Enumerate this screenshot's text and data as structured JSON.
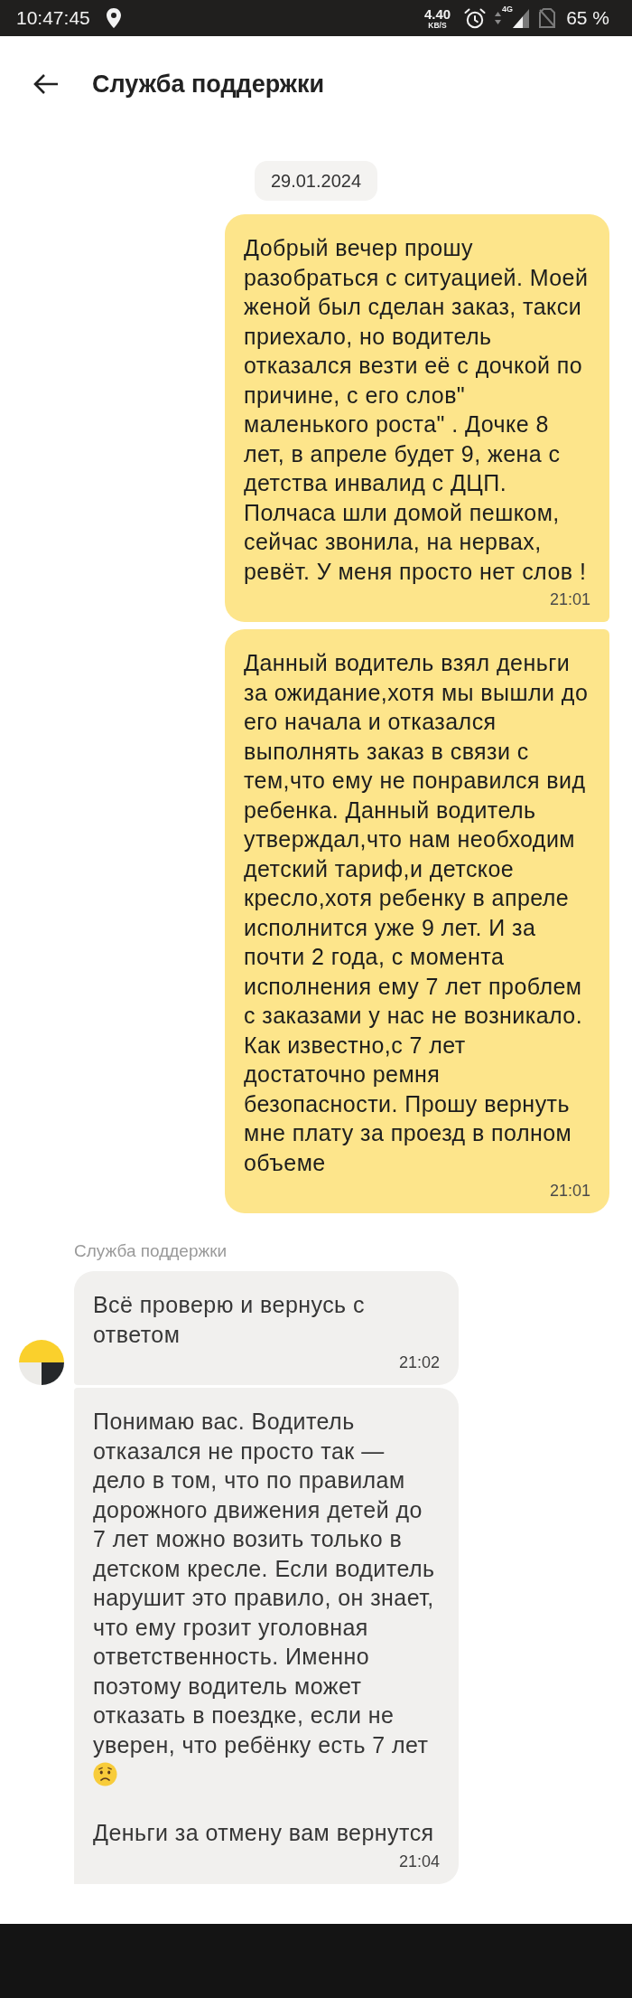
{
  "status_bar": {
    "time": "10:47:45",
    "net_speed": "4.40",
    "net_speed_unit": "KB/S",
    "network_type": "4G",
    "battery": "65 %"
  },
  "header": {
    "title": "Служба поддержки"
  },
  "chat": {
    "date": "29.01.2024",
    "groups": [
      {
        "kind": "outgoing",
        "messages": [
          {
            "time": "21:01",
            "parts": [
              {
                "kind": "text",
                "text": "Добрый вечер прошу разобраться с ситуацией. Моей женой был сделан заказ, такси приехало, но водитель отказался везти её с дочкой по причине, с его слов\" маленького роста\" . Дочке 8 лет, в апреле будет 9, жена с детства инвалид с ДЦП. Полчаса шли домой пешком, сейчас звонила, на нервах, ревёт. У меня просто нет слов !"
              }
            ]
          },
          {
            "time": "21:01",
            "parts": [
              {
                "kind": "text",
                "text": "Данный водитель взял деньги за ожидание,хотя мы вышли до его начала и отказался выполнять заказ в связи с тем,что ему не понравился вид ребенка. Данный водитель утверждал,что нам необходим детский тариф,и детское кресло,хотя ребенку в апреле исполнится уже 9 лет. И за почти 2 года, с момента исполнения ему 7 лет проблем с заказами у нас не возникало. Как известно,с 7 лет достаточно ремня безопасности. Прошу вернуть мне плату за проезд в полном объеме"
              }
            ]
          }
        ]
      },
      {
        "kind": "incoming",
        "label": "Служба поддержки",
        "messages": [
          {
            "avatar": true,
            "time": "21:02",
            "parts": [
              {
                "kind": "text",
                "text": "Всё проверю и вернусь с ответом"
              }
            ]
          },
          {
            "avatar": false,
            "time": "21:04",
            "parts": [
              {
                "kind": "text",
                "text": "Понимаю вас. Водитель отказался не просто так — дело в том, что по правилам дорожного движения детей до 7 лет можно возить только в детском кресле. Если водитель нарушит это правило, он знает, что ему грозит уголовная ответственность. Именно поэтому водитель может отказать в поездке, если не уверен, что ребёнку есть 7 лет"
              },
              {
                "kind": "emoji"
              },
              {
                "kind": "text",
                "text": "Деньги за отмену вам вернутся"
              }
            ]
          }
        ]
      }
    ]
  }
}
